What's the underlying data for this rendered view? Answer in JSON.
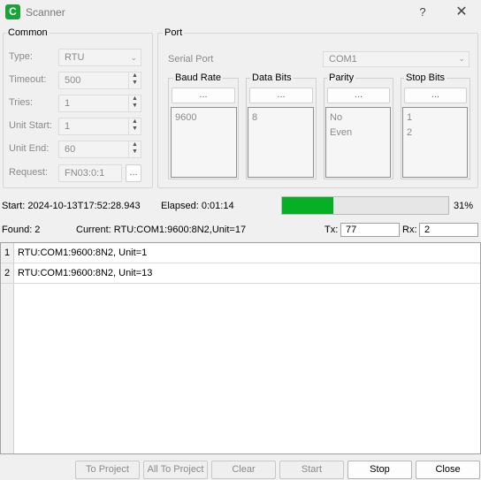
{
  "window": {
    "title": "Scanner",
    "icon_letter": "C",
    "help_label": "?",
    "close_label": "✕"
  },
  "common": {
    "title": "Common",
    "type": {
      "label": "Type:",
      "value": "RTU"
    },
    "timeout": {
      "label": "Timeout:",
      "value": "500"
    },
    "tries": {
      "label": "Tries:",
      "value": "1"
    },
    "unit_start": {
      "label": "Unit Start:",
      "value": "1"
    },
    "unit_end": {
      "label": "Unit End:",
      "value": "60"
    },
    "request": {
      "label": "Request:",
      "value": "FN03:0:1",
      "button": "..."
    }
  },
  "port": {
    "title": "Port",
    "serial_port": {
      "label": "Serial Port",
      "value": "COM1"
    },
    "baud_rate": {
      "title": "Baud Rate",
      "button": "...",
      "items": [
        "9600"
      ]
    },
    "data_bits": {
      "title": "Data Bits",
      "button": "...",
      "items": [
        "8"
      ]
    },
    "parity": {
      "title": "Parity",
      "button": "...",
      "items": [
        "No",
        "Even"
      ]
    },
    "stop_bits": {
      "title": "Stop Bits",
      "button": "...",
      "items": [
        "1",
        "2"
      ]
    }
  },
  "status": {
    "start": "Start: 2024-10-13T17:52:28.943",
    "elapsed": "Elapsed: 0:01:14",
    "progress_percent": 31,
    "progress_label": "31%",
    "found": "Found: 2",
    "current": "Current: RTU:COM1:9600:8N2,Unit=17",
    "tx_label": "Tx:",
    "tx_value": "77",
    "rx_label": "Rx:",
    "rx_value": "2"
  },
  "results": [
    {
      "num": "1",
      "text": "RTU:COM1:9600:8N2, Unit=1"
    },
    {
      "num": "2",
      "text": "RTU:COM1:9600:8N2, Unit=13"
    }
  ],
  "buttons": {
    "to_project": "To Project",
    "all_to_project": "All To Project",
    "clear": "Clear",
    "start": "Start",
    "stop": "Stop",
    "close": "Close"
  },
  "colors": {
    "accent": "#06b025",
    "icon": "#1aa33a"
  }
}
